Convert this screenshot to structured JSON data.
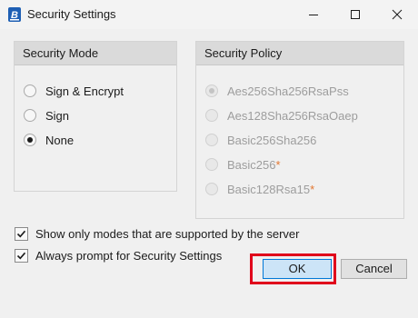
{
  "window": {
    "title": "Security Settings",
    "app_icon": "opc-app-icon"
  },
  "security_mode": {
    "header": "Security Mode",
    "options": [
      {
        "label": "Sign & Encrypt",
        "selected": false
      },
      {
        "label": "Sign",
        "selected": false
      },
      {
        "label": "None",
        "selected": true
      }
    ]
  },
  "security_policy": {
    "header": "Security Policy",
    "enabled": false,
    "options": [
      {
        "label": "Aes256Sha256RsaPss",
        "selected": true,
        "marker": ""
      },
      {
        "label": "Aes128Sha256RsaOaep",
        "selected": false,
        "marker": ""
      },
      {
        "label": "Basic256Sha256",
        "selected": false,
        "marker": ""
      },
      {
        "label": "Basic256",
        "selected": false,
        "marker": "*"
      },
      {
        "label": "Basic128Rsa15",
        "selected": false,
        "marker": "*"
      }
    ],
    "marker_color": "#e3762f"
  },
  "options": {
    "show_supported_only": {
      "label": "Show only modes that are supported by the server",
      "checked": true
    },
    "always_prompt": {
      "label": "Always prompt for Security Settings",
      "checked": true
    }
  },
  "buttons": {
    "ok": "OK",
    "cancel": "Cancel"
  },
  "highlight_color": "#e0001b"
}
